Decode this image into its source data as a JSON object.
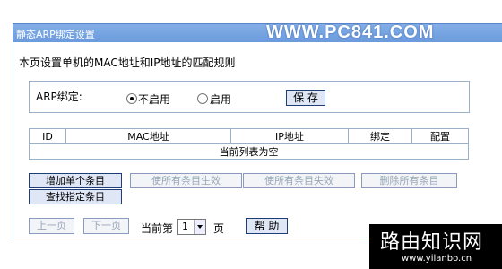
{
  "window": {
    "title": "静态ARP绑定设置"
  },
  "watermark": {
    "site": "WWW.PC841.COM",
    "brand": "路由知识网",
    "url": "www.yilanbo.cn"
  },
  "page": {
    "description": "本页设置单机的MAC地址和IP地址的匹配规则"
  },
  "arp_binding": {
    "label": "ARP绑定:",
    "options": [
      {
        "label": "不启用",
        "selected": true
      },
      {
        "label": "启用",
        "selected": false
      }
    ],
    "save_label": "保 存"
  },
  "table": {
    "headers": [
      "ID",
      "MAC地址",
      "IP地址",
      "绑定",
      "配置"
    ],
    "empty_message": "当前列表为空"
  },
  "actions": {
    "add_single": "增加单个条目",
    "enable_all": "使所有条目生效",
    "disable_all": "使所有条目失效",
    "delete_all": "删除所有条目",
    "find": "查找指定条目"
  },
  "pagination": {
    "prev": "上一页",
    "next": "下一页",
    "current_prefix": "当前第",
    "page_value": "1",
    "page_suffix": "页",
    "help": "帮 助"
  }
}
